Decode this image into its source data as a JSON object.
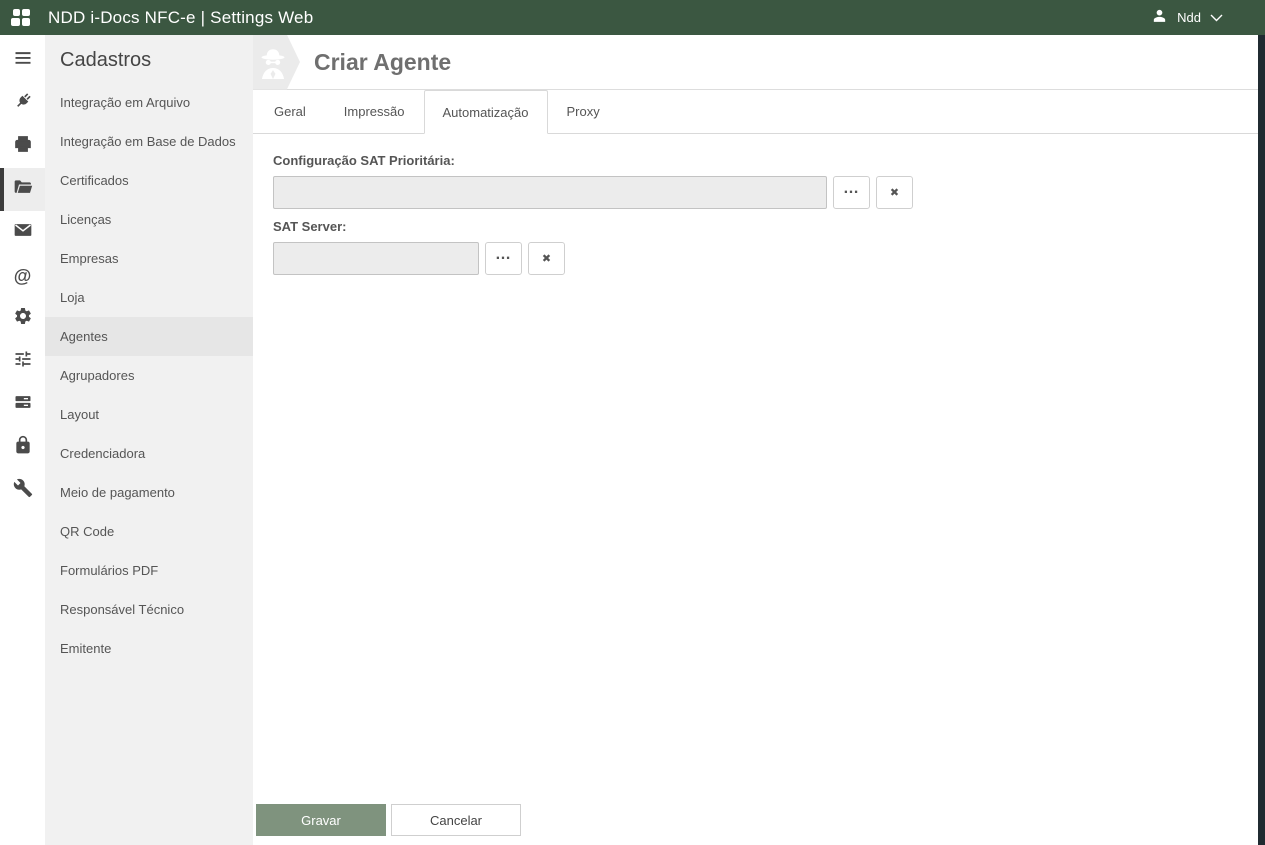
{
  "topbar": {
    "title": "NDD i-Docs NFC-e | Settings Web",
    "user_name": "Ndd"
  },
  "icon_rail": {
    "items": [
      {
        "icon": "menu-icon",
        "selected": false
      },
      {
        "icon": "plug-icon",
        "selected": false
      },
      {
        "icon": "printer-icon",
        "selected": false
      },
      {
        "icon": "folder-open-icon",
        "selected": true
      },
      {
        "icon": "mail-icon",
        "selected": false
      },
      {
        "icon": "at-sign-icon",
        "glyph": "@",
        "selected": false
      },
      {
        "icon": "gear-icon",
        "selected": false
      },
      {
        "icon": "sliders-icon",
        "selected": false
      },
      {
        "icon": "server-icon",
        "selected": false
      },
      {
        "icon": "lock-icon",
        "selected": false
      },
      {
        "icon": "wrench-icon",
        "selected": false
      }
    ]
  },
  "sidebar": {
    "heading": "Cadastros",
    "items": [
      {
        "label": "Integração em Arquivo",
        "selected": false
      },
      {
        "label": "Integração em Base de Dados",
        "selected": false
      },
      {
        "label": "Certificados",
        "selected": false
      },
      {
        "label": "Licenças",
        "selected": false
      },
      {
        "label": "Empresas",
        "selected": false
      },
      {
        "label": "Loja",
        "selected": false
      },
      {
        "label": "Agentes",
        "selected": true
      },
      {
        "label": "Agrupadores",
        "selected": false
      },
      {
        "label": "Layout",
        "selected": false
      },
      {
        "label": "Credenciadora",
        "selected": false
      },
      {
        "label": "Meio de pagamento",
        "selected": false
      },
      {
        "label": "QR Code",
        "selected": false
      },
      {
        "label": "Formulários PDF",
        "selected": false
      },
      {
        "label": "Responsável Técnico",
        "selected": false
      },
      {
        "label": "Emitente",
        "selected": false
      }
    ]
  },
  "main": {
    "title": "Criar Agente",
    "tabs": [
      {
        "label": "Geral",
        "active": false
      },
      {
        "label": "Impressão",
        "active": false
      },
      {
        "label": "Automatização",
        "active": true
      },
      {
        "label": "Proxy",
        "active": false
      }
    ],
    "form": {
      "fields": [
        {
          "label": "Configuração SAT Prioritária:",
          "value": ""
        },
        {
          "label": "SAT Server:",
          "value": ""
        }
      ],
      "browse_label": "…",
      "clear_label": "✖"
    },
    "actions": {
      "save_label": "Gravar",
      "cancel_label": "Cancelar"
    }
  },
  "colors": {
    "topbar_green": "#3b5741",
    "save_green": "#7f937e",
    "sidebar_bg": "#f1f1f1",
    "selected_item_bg": "#e6e6e6",
    "edge_strip": "#202b31"
  }
}
